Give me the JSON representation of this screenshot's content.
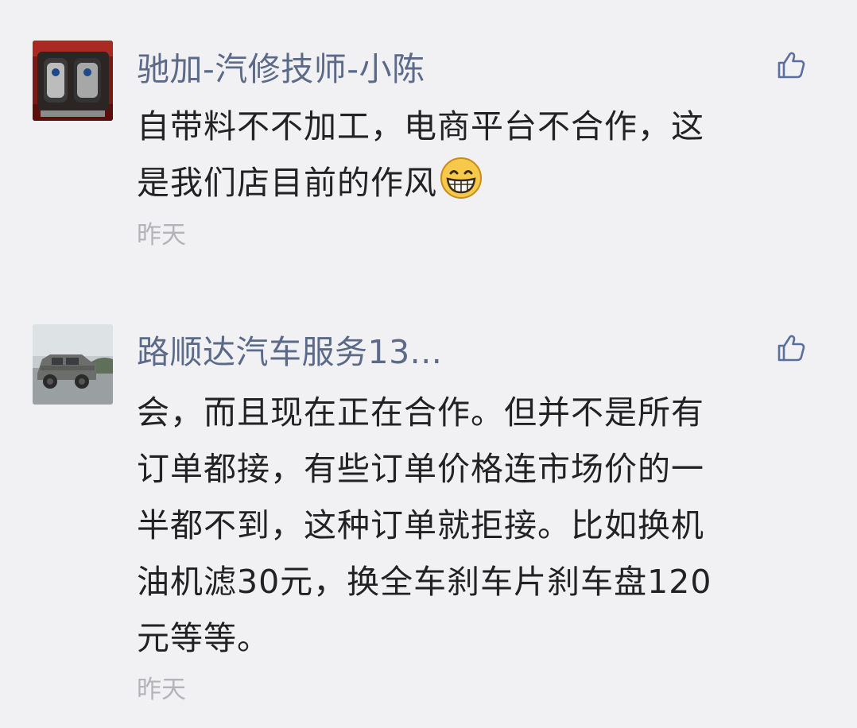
{
  "comments": [
    {
      "username": "驰加-汽修技师-小陈",
      "lines": [
        "自带料不不加工，电商平台不合作，这",
        "是我们店目前的作风"
      ],
      "emoji": "grinning-face-icon",
      "time": "昨天",
      "like_icon": "thumbs-up-icon",
      "avatar": "car-key-fob-photo"
    },
    {
      "username": "路顺达汽车服务13...",
      "lines": [
        "会，而且现在正在合作。但并不是所有",
        "订单都接，有些订单价格连市场价的一",
        "半都不到，这种订单就拒接。比如换机",
        "油机滤30元，换全车刹车片刹车盘120",
        "元等等。"
      ],
      "time": "昨天",
      "like_icon": "thumbs-up-icon",
      "avatar": "armored-vehicle-photo"
    }
  ],
  "colors": {
    "background": "#f1f1f3",
    "username": "#5c6a89",
    "body": "#222222",
    "timestamp": "#b4b4b8",
    "like_icon": "#5a6fa0"
  }
}
